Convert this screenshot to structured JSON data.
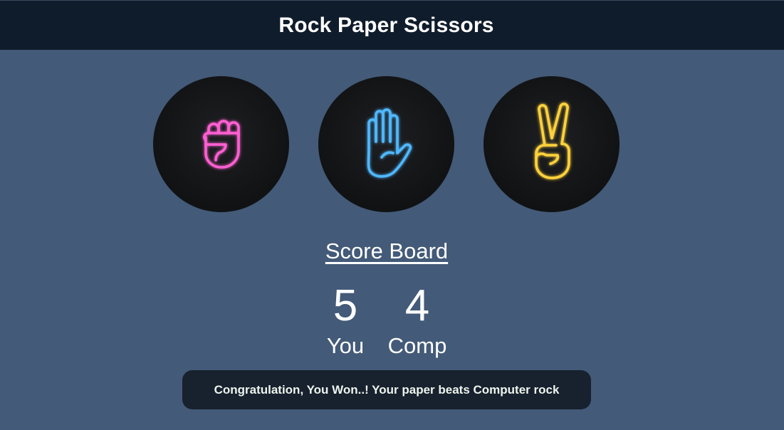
{
  "header": {
    "title": "Rock Paper Scissors"
  },
  "choices": [
    {
      "id": "rock",
      "icon": "rock-fist-icon",
      "color": "#ff5fd2"
    },
    {
      "id": "paper",
      "icon": "paper-open-hand-icon",
      "color": "#4fb8ff"
    },
    {
      "id": "scissors",
      "icon": "scissors-peace-hand-icon",
      "color": "#ffd23a"
    }
  ],
  "scoreboard": {
    "title": "Score Board",
    "user_score": "5",
    "user_label": "You",
    "comp_score": "4",
    "comp_label": "Comp"
  },
  "message": {
    "text": "Congratulation, You Won..! Your paper beats Computer rock"
  },
  "colors": {
    "background": "#435a78",
    "header_bg": "#0f1c2b",
    "message_bg": "#18212e"
  }
}
